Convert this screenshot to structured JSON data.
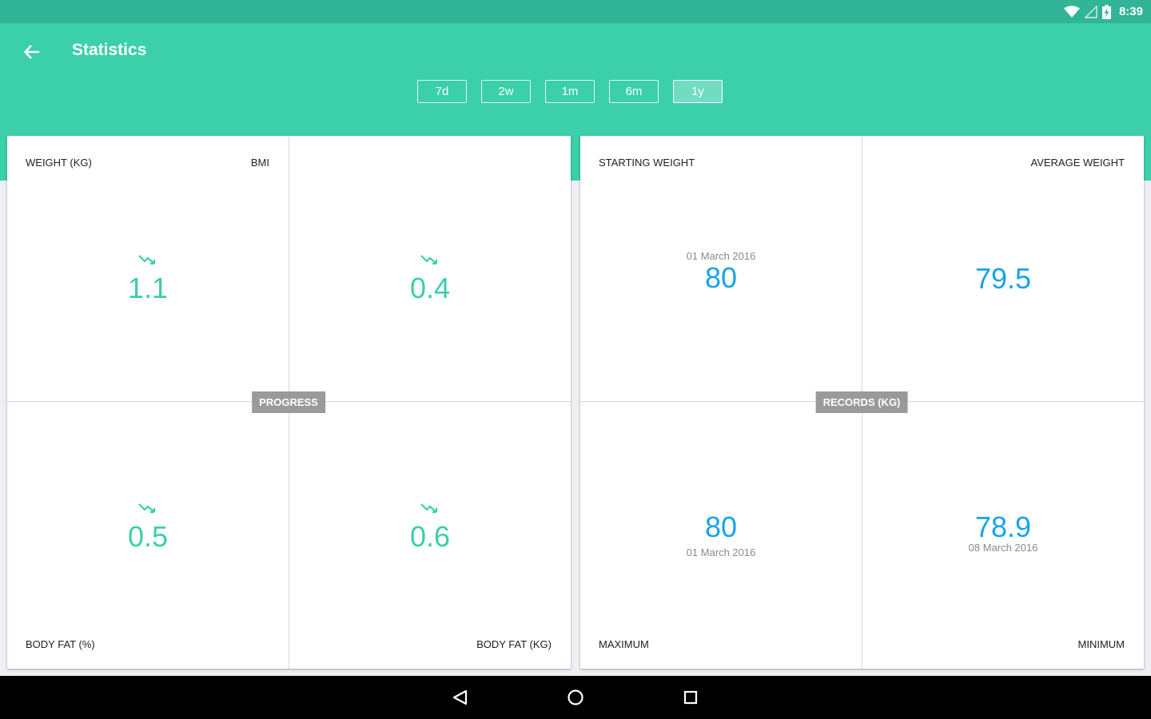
{
  "status_bar": {
    "time": "8:39",
    "icons": [
      "wifi-icon",
      "signal-icon",
      "battery-charging-icon"
    ]
  },
  "app_bar": {
    "title": "Statistics",
    "back_icon": "arrow-back-icon",
    "ranges": [
      {
        "label": "7d",
        "active": false
      },
      {
        "label": "2w",
        "active": false
      },
      {
        "label": "1m",
        "active": false
      },
      {
        "label": "6m",
        "active": false
      },
      {
        "label": "1y",
        "active": true
      }
    ]
  },
  "progress": {
    "tag": "PROGRESS",
    "trend_icon": "trending-down-icon",
    "weight": {
      "label": "WEIGHT (KG)",
      "value": "1.1"
    },
    "bmi": {
      "label": "BMI",
      "value": "0.4"
    },
    "body_fat_pct": {
      "label": "BODY FAT (%)",
      "value": "0.5"
    },
    "body_fat_kg": {
      "label": "BODY FAT (KG)",
      "value": "0.6"
    }
  },
  "records": {
    "tag": "RECORDS (KG)",
    "starting": {
      "label": "STARTING WEIGHT",
      "date": "01 March 2016",
      "value": "80"
    },
    "average": {
      "label": "AVERAGE WEIGHT",
      "value": "79.5"
    },
    "maximum": {
      "label": "MAXIMUM",
      "date": "01 March 2016",
      "value": "80"
    },
    "minimum": {
      "label": "MINIMUM",
      "date": "08 March 2016",
      "value": "78.9"
    }
  },
  "colors": {
    "accent": "#3bcfaa",
    "status_bar": "#31b596",
    "value_blue": "#1aa3e8",
    "tag_gray": "#9a9a9a"
  },
  "nav_bar": {
    "icons": [
      "nav-back-icon",
      "nav-home-icon",
      "nav-recents-icon"
    ]
  }
}
